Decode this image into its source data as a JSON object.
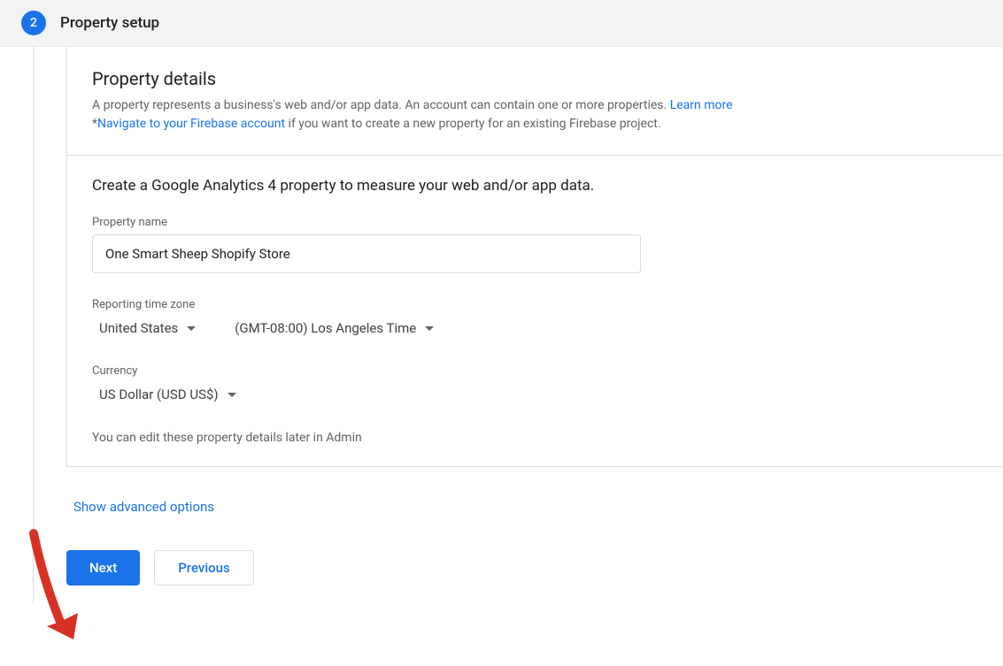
{
  "step": {
    "number": "2",
    "title": "Property setup"
  },
  "details": {
    "heading": "Property details",
    "description": "A property represents a business's web and/or app data. An account can contain one or more properties. ",
    "learn_more": "Learn more",
    "firebase_prefix": "*",
    "firebase_link": "Navigate to your Firebase account",
    "firebase_suffix": " if you want to create a new property for an existing Firebase project."
  },
  "form": {
    "subheading": "Create a Google Analytics 4 property to measure your web and/or app data.",
    "property_name_label": "Property name",
    "property_name_value": "One Smart Sheep Shopify Store",
    "timezone_label": "Reporting time zone",
    "timezone_country": "United States",
    "timezone_value": "(GMT-08:00) Los Angeles Time",
    "currency_label": "Currency",
    "currency_value": "US Dollar (USD US$)",
    "note": "You can edit these property details later in Admin"
  },
  "advanced_link": "Show advanced options",
  "buttons": {
    "next": "Next",
    "previous": "Previous"
  }
}
